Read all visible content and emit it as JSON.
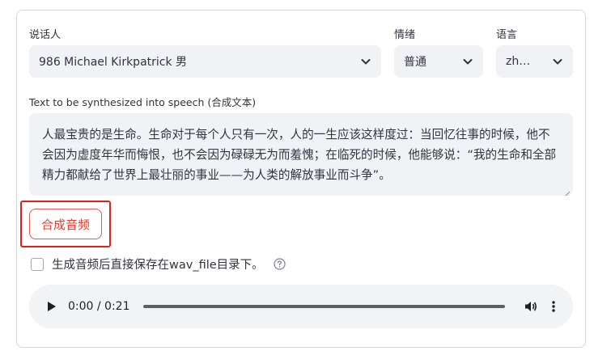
{
  "form": {
    "speaker": {
      "label": "说话人",
      "value": "986 Michael Kirkpatrick 男"
    },
    "emotion": {
      "label": "情绪",
      "value": "普通"
    },
    "language": {
      "label": "语言",
      "value": "zh…"
    },
    "text": {
      "label": "Text to be synthesized into speech (合成文本)",
      "value": "人最宝贵的是生命。生命对于每个人只有一次，人的一生应该这样度过：当回忆往事的时候，他不会因为虚度年华而悔恨，也不会因为碌碌无为而羞愧；在临死的时候，他能够说：“我的生命和全部精力都献给了世界上最壮丽的事业——为人类的解放事业而斗争”。"
    },
    "synthesize_button": "合成音频",
    "save_checkbox": {
      "label": "生成音频后直接保存在wav_file目录下。",
      "checked": false
    }
  },
  "audio": {
    "time": "0:00 / 0:21",
    "progress": 0
  },
  "colors": {
    "accent": "#e0402f",
    "highlight": "#e0201c",
    "input_bg": "#f0f2f6"
  }
}
